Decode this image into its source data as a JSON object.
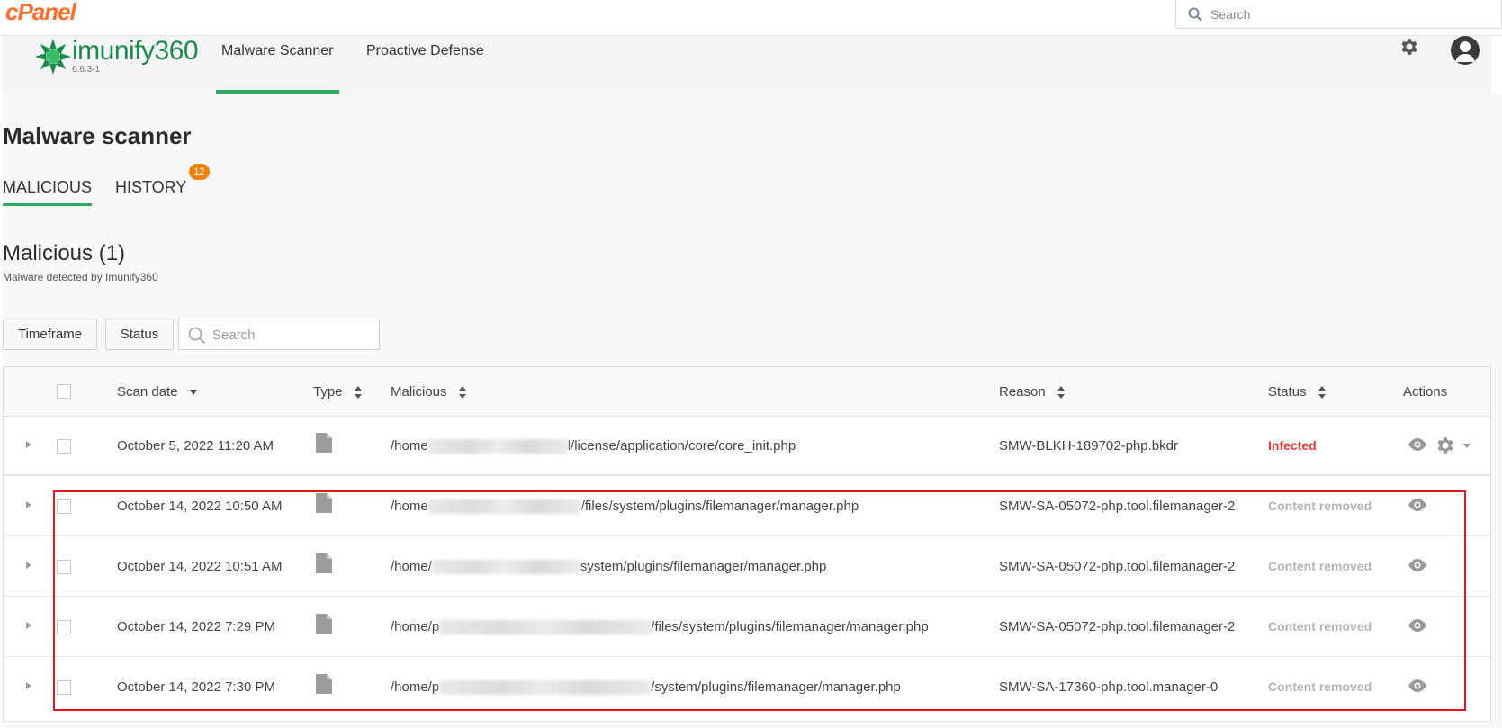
{
  "cpanel": {
    "logo": "cPanel",
    "search_placeholder": "Search"
  },
  "imunify": {
    "brand": "imunify360",
    "version": "6.6.3-1"
  },
  "nav": {
    "tabs": [
      {
        "label": "Malware Scanner",
        "active": true
      },
      {
        "label": "Proactive Defense",
        "active": false
      }
    ]
  },
  "page": {
    "title": "Malware scanner"
  },
  "subtabs": [
    {
      "label": "MALICIOUS",
      "active": true
    },
    {
      "label": "HISTORY",
      "active": false
    }
  ],
  "history_badge": "12",
  "section": {
    "title": "Malicious (1)",
    "subtitle": "Malware detected by Imunify360"
  },
  "filters": {
    "timeframe": "Timeframe",
    "status": "Status",
    "search_placeholder": "Search"
  },
  "table": {
    "headers": {
      "scan_date": "Scan date",
      "type": "Type",
      "malicious": "Malicious",
      "reason": "Reason",
      "status": "Status",
      "actions": "Actions"
    },
    "rows": [
      {
        "date": "October 5, 2022 11:20 AM",
        "path_prefix": "/home",
        "path_suffix": "l/license/application/core/core_init.php",
        "reason": "SMW-BLKH-189702-php.bkdr",
        "status": "Infected"
      },
      {
        "date": "October 14, 2022 10:50 AM",
        "path_prefix": "/home",
        "path_suffix": "/files/system/plugins/filemanager/manager.php",
        "reason": "SMW-SA-05072-php.tool.filemanager-2",
        "status": "Content removed"
      },
      {
        "date": "October 14, 2022 10:51 AM",
        "path_prefix": "/home/",
        "path_suffix": "system/plugins/filemanager/manager.php",
        "reason": "SMW-SA-05072-php.tool.filemanager-2",
        "status": "Content removed"
      },
      {
        "date": "October 14, 2022 7:29 PM",
        "path_prefix": "/home/p",
        "path_suffix": "/files/system/plugins/filemanager/manager.php",
        "reason": "SMW-SA-05072-php.tool.filemanager-2",
        "status": "Content removed"
      },
      {
        "date": "October 14, 2022 7:30 PM",
        "path_prefix": "/home/p",
        "path_suffix": "/system/plugins/filemanager/manager.php",
        "reason": "SMW-SA-17360-php.tool.manager-0",
        "status": "Content removed"
      }
    ]
  },
  "colors": {
    "accent": "#2eaa5f",
    "infected": "#e53935",
    "badge": "#f0820a",
    "cpanel": "#ff6c2c",
    "highlight": "#e8141e"
  }
}
